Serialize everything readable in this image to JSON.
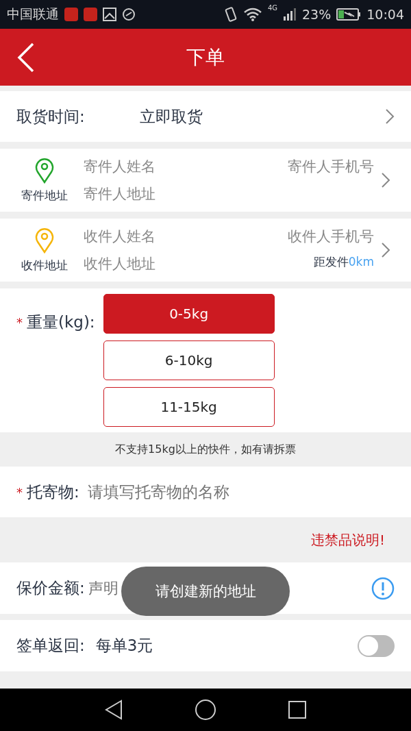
{
  "status_bar": {
    "carrier": "中国联通",
    "network": "4G",
    "battery": "23%",
    "time": "10:04"
  },
  "header": {
    "title": "下单"
  },
  "pickup": {
    "label": "取货时间:",
    "value": "立即取货"
  },
  "addresses": [
    {
      "kind": "sender",
      "label": "寄件地址",
      "name_placeholder": "寄件人姓名",
      "phone_placeholder": "寄件人手机号",
      "address_placeholder": "寄件人地址",
      "color": "#22a52c"
    },
    {
      "kind": "receiver",
      "label": "收件地址",
      "name_placeholder": "收件人姓名",
      "phone_placeholder": "收件人手机号",
      "address_placeholder": "收件人地址",
      "color": "#f5b50a",
      "distance_label": "距发件",
      "distance_value": "0km"
    }
  ],
  "weight": {
    "required_mark": "*",
    "label": "重量(kg):",
    "options": [
      {
        "label": "0-5kg",
        "selected": true
      },
      {
        "label": "6-10kg",
        "selected": false
      },
      {
        "label": "11-15kg",
        "selected": false
      }
    ],
    "notice": "不支持15kg以上的快件，如有请拆票"
  },
  "item": {
    "required_mark": "*",
    "label": "托寄物:",
    "placeholder": "请填写托寄物的名称"
  },
  "prohibited_link": "违禁品说明!",
  "insurance": {
    "label": "保价金额:",
    "placeholder": "声明"
  },
  "sign_return": {
    "label": "签单返回:",
    "value": "每单3元",
    "on": false
  },
  "toast": "请创建新的地址"
}
